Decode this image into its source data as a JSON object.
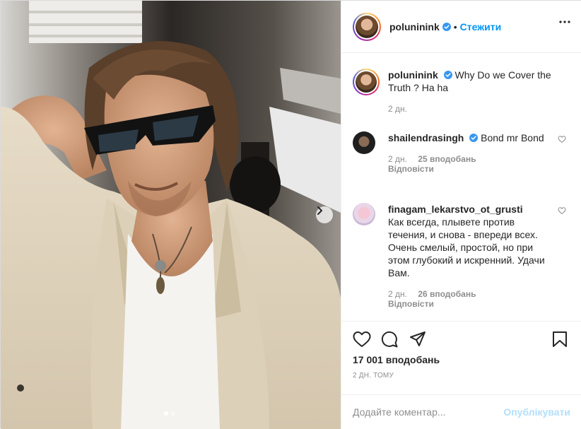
{
  "post": {
    "author": "poluninink",
    "follow_label": "Стежити",
    "separator": "•",
    "caption": {
      "username": "poluninink",
      "text": "Why Do we Cover the Truth ? Ha ha",
      "age": "2 дн."
    }
  },
  "comments": [
    {
      "username": "shailendrasingh",
      "verified": true,
      "text": "Bond mr Bond",
      "age": "2 дн.",
      "likes": "25 вподобань",
      "reply_label": "Відповісти"
    },
    {
      "username": "finagam_lekarstvo_ot_grusti",
      "verified": false,
      "text": "Как всегда, плывете против течения, и снова - впереди всех. Очень смелый, простой, но при этом глубокий и искренний. Удачи Вам.",
      "age": "2 дн.",
      "likes": "26 вподобань",
      "reply_label": "Відповісти"
    }
  ],
  "stats": {
    "likes": "17 001 вподобань",
    "timestamp": "2 ДН. ТОМУ"
  },
  "composer": {
    "placeholder": "Додайте коментар...",
    "publish_label": "Опублікувати"
  },
  "carousel": {
    "current": 1,
    "total": 2
  },
  "colors": {
    "link": "#0095f6",
    "publish_disabled": "#b2dffc",
    "muted": "#8e8e8e",
    "text": "#262626"
  },
  "icons": [
    "verified-badge-icon",
    "more-options-icon",
    "heart-icon",
    "comment-icon",
    "share-icon",
    "bookmark-icon",
    "chevron-right-icon"
  ]
}
